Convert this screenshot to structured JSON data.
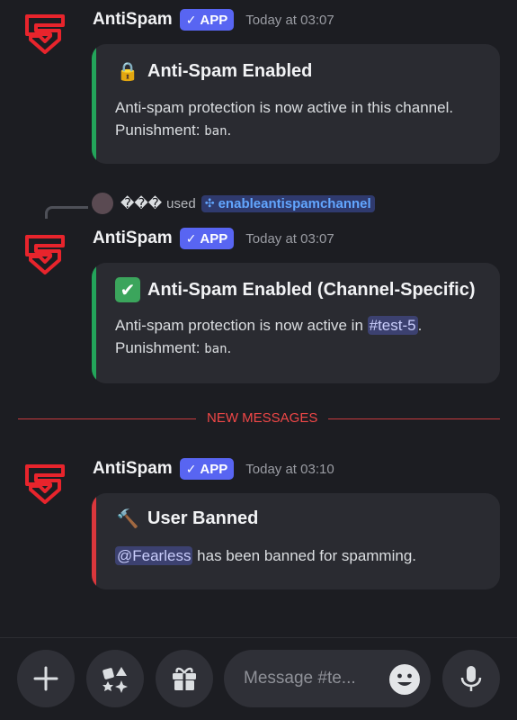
{
  "messages": [
    {
      "author": "AntiSpam",
      "badge": "APP",
      "timestamp": "Today at 03:07",
      "embed": {
        "emoji": "🔒",
        "title": "Anti-Spam Enabled",
        "desc_before": "Anti-spam protection is now active in this channel. Punishment: ",
        "punishment": "ban",
        "desc_after": ".",
        "bar_color": "#23a55a"
      }
    },
    {
      "reply": {
        "username": "���",
        "used_text": "used",
        "command": "enableantispamchannel"
      },
      "author": "AntiSpam",
      "badge": "APP",
      "timestamp": "Today at 03:07",
      "embed": {
        "emoji": "✅",
        "title": "Anti-Spam Enabled (Channel-Specific)",
        "desc_before": "Anti-spam protection is now active in ",
        "channel": "#test-5",
        "desc_mid": ". Punishment: ",
        "punishment": "ban",
        "desc_after": ".",
        "bar_color": "#23a55a"
      }
    },
    {
      "author": "AntiSpam",
      "badge": "APP",
      "timestamp": "Today at 03:10",
      "embed": {
        "emoji": "🔨",
        "title": "User Banned",
        "mention": "@Fearless",
        "desc_after": " has been banned for spamming.",
        "bar_color": "#da373c"
      }
    }
  ],
  "divider_label": "NEW MESSAGES",
  "composer": {
    "placeholder": "Message #te...",
    "icons": [
      "plus-icon",
      "apps-icon",
      "gift-icon",
      "emoji-icon",
      "microphone-icon"
    ]
  },
  "colors": {
    "background": "#1c1d22",
    "brand": "#5865f2",
    "logo_red": "#e8242c",
    "success": "#23a55a",
    "danger": "#da373c"
  }
}
